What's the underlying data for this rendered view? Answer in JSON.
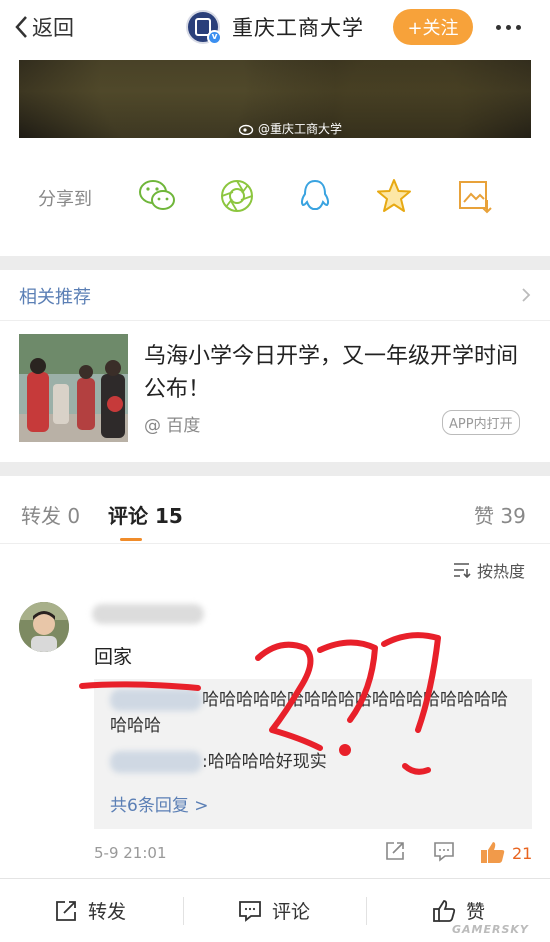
{
  "nav": {
    "back_label": "返回",
    "account_name": "重庆工商大学",
    "follow_label": "+关注"
  },
  "media": {
    "watermark": "@重庆工商大学"
  },
  "share": {
    "label": "分享到",
    "targets": [
      "wechat-icon",
      "moments-icon",
      "qq-icon",
      "favorite-icon",
      "save-image-icon"
    ]
  },
  "related": {
    "header": "相关推荐",
    "item": {
      "title": "乌海小学今日开学，又一年级开学时间公布！",
      "source": "@ 百度",
      "app_badge": "APP内打开"
    }
  },
  "tabs": {
    "repost_label": "转发",
    "repost_count": "0",
    "comment_label": "评论",
    "comment_count": "15",
    "like_label": "赞",
    "like_count": "39"
  },
  "comments": {
    "sort_label": "按热度",
    "items": [
      {
        "text": "回家",
        "replies": [
          {
            "text": "哈哈哈哈哈哈哈哈哈哈哈哈哈哈哈哈哈哈哈哈哈"
          },
          {
            "text": ":哈哈哈哈好现实"
          }
        ],
        "more_replies": "共6条回复 >",
        "time": "5-9 21:01",
        "likes": "21"
      }
    ]
  },
  "bottom_bar": {
    "repost_label": "转发",
    "comment_label": "评论",
    "like_label": "赞"
  },
  "annotation_mark": "一 ???",
  "source_watermark": "GAMERSKY",
  "colors": {
    "accent_orange": "#f7a23a",
    "link_blue": "#5b7fb5",
    "like_orange": "#e8641f",
    "scribble_red": "#e8202a"
  }
}
